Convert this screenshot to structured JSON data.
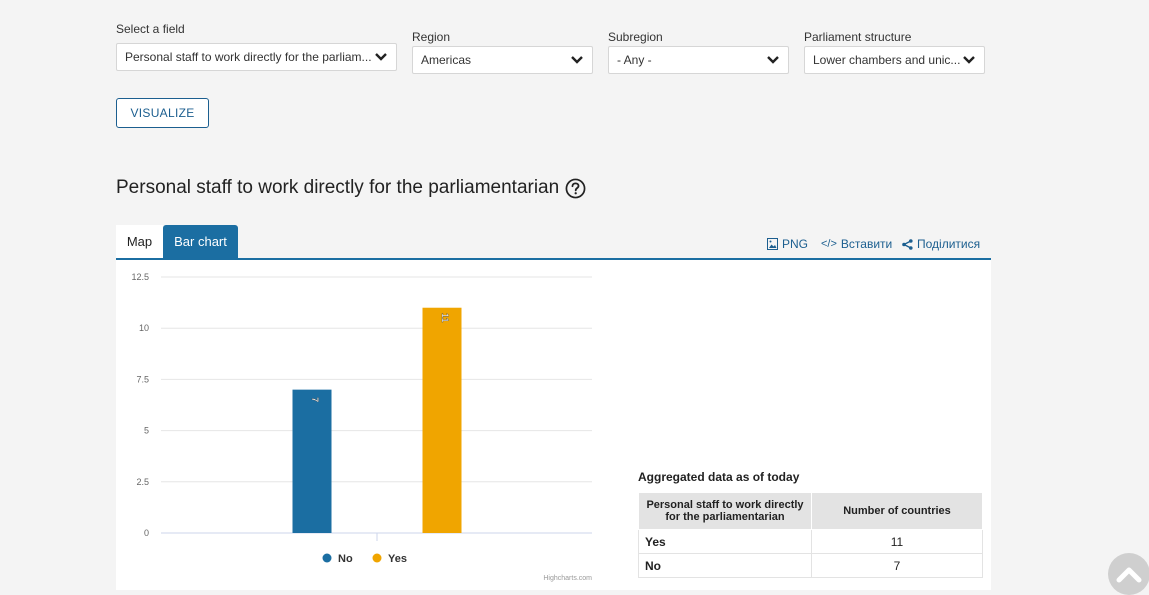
{
  "filters": {
    "field": {
      "label": "Select a field",
      "value": "Personal staff to work directly for the parliam..."
    },
    "region": {
      "label": "Region",
      "value": "Americas"
    },
    "subregion": {
      "label": "Subregion",
      "value": "- Any -"
    },
    "structure": {
      "label": "Parliament structure",
      "value": "Lower chambers and unic..."
    }
  },
  "visualize_label": "VISUALIZE",
  "page_title": "Personal staff to work directly for the parliamentarian",
  "tabs": [
    {
      "label": "Map"
    },
    {
      "label": "Bar chart"
    }
  ],
  "tools": {
    "png": "PNG",
    "embed": "Вставити",
    "share": "Поділитися"
  },
  "credits": "Highcharts.com",
  "chart_data": {
    "type": "bar",
    "categories": [
      "No",
      "Yes"
    ],
    "values": [
      7,
      11
    ],
    "data_labels": [
      "7",
      "11"
    ],
    "ylim": [
      0,
      12.5
    ],
    "yticks": [
      "0",
      "2.5",
      "5",
      "7.5",
      "10",
      "12.5"
    ],
    "colors": [
      "#1b6ea2",
      "#f0a500"
    ],
    "legend": [
      {
        "name": "No",
        "color": "#1b6ea2"
      },
      {
        "name": "Yes",
        "color": "#f0a500"
      }
    ],
    "legend_position": "bottom-center",
    "grid": true
  },
  "aggregate": {
    "title": "Aggregated data as of today",
    "headers": [
      "Personal staff to work directly for the parliamentarian",
      "Number of countries"
    ],
    "rows": [
      {
        "label": "Yes",
        "value": "11"
      },
      {
        "label": "No",
        "value": "7"
      }
    ]
  }
}
